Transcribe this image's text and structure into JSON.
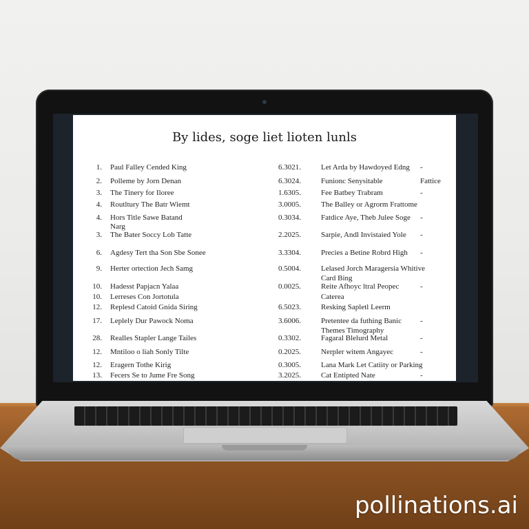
{
  "document": {
    "title": "By lides, soge liet lioten lunls",
    "rows": [
      {
        "num": "1.",
        "title": "Paul Falley Cended King",
        "value": "6.3021.",
        "desc": "Let Arda by Hawdoyed Edng",
        "mark": "-"
      },
      {
        "num": "2.",
        "title": "Polleme by Jorn Denan",
        "value": "6.3024.",
        "desc": "Funionc Senysitable",
        "mark": "Fattice"
      },
      {
        "num": "3.",
        "title": "The Tinery for Iloree",
        "value": "1.6305.",
        "desc": "Fee Batbey Trabram",
        "mark": "-"
      },
      {
        "num": "4.",
        "title": "Routltury The Batr Wiemt",
        "value": "3.0005.",
        "desc": "The Balley or Agrorm Frattome",
        "mark": ""
      },
      {
        "num": "4.",
        "title": "Hors Title Sawe Batand",
        "value": "0.3034.",
        "desc": "Fatdice Aye, Theb Julee Soge",
        "mark": "-"
      },
      {
        "num": "",
        "title": "Narg",
        "value": "",
        "desc": "",
        "mark": ""
      },
      {
        "num": "3.",
        "title": "The Bater Soccy Lob Tatte",
        "value": "2.2025.",
        "desc": "Sarpie, Andl Invistaied Yole",
        "mark": "-"
      },
      {
        "num": "6.",
        "title": "Agdesy Tert tha Son Sbe Sonee",
        "value": "3.3304.",
        "desc": "Precies a Betine Robrd High",
        "mark": "-"
      },
      {
        "num": "9.",
        "title": "Herter ortection Jech Samg",
        "value": "0.5004.",
        "desc": "Lelased Jorch Maragersia Whitive",
        "mark": ""
      },
      {
        "num": "",
        "title": "",
        "value": "",
        "desc": "Card Bing",
        "mark": ""
      },
      {
        "num": "10.",
        "title": "Hadesst Papjacn Yalaa",
        "value": "0.0025.",
        "desc": "Reite Afhoyc ltral Peopec",
        "mark": "-"
      },
      {
        "num": "10.",
        "title": "Lerreses Con Jortotula",
        "value": "",
        "desc": "Caterea",
        "mark": ""
      },
      {
        "num": "12.",
        "title": "Replesd Catoid Gnida Siring",
        "value": "6.5023.",
        "desc": "Resking Sapletl Leerm",
        "mark": ""
      },
      {
        "num": "17.",
        "title": "Leplely Dur Pawock Noma",
        "value": "3.6006.",
        "desc": "Pretentee da futhing Banic",
        "mark": "-"
      },
      {
        "num": "",
        "title": "",
        "value": "",
        "desc": "Themes Timography",
        "mark": ""
      },
      {
        "num": "28.",
        "title": "Realles Stapler Lange Tailes",
        "value": "0.3302.",
        "desc": "Fagaral Blelurd Metal",
        "mark": "-"
      },
      {
        "num": "12.",
        "title": "Mntiloo o liah Sonly Tilte",
        "value": "0.2025.",
        "desc": "Nerpler witem Angayec",
        "mark": "-"
      },
      {
        "num": "12.",
        "title": "Eragern Tothe Kirig",
        "value": "0.3005.",
        "desc": "Lana Mark Let Catiity or Parking",
        "mark": ""
      },
      {
        "num": "13.",
        "title": "Fecers Se to Jume Fre Song",
        "value": "3.2025.",
        "desc": "Cat Entipted Nate",
        "mark": "-"
      }
    ]
  },
  "watermark": "pollinations.ai"
}
